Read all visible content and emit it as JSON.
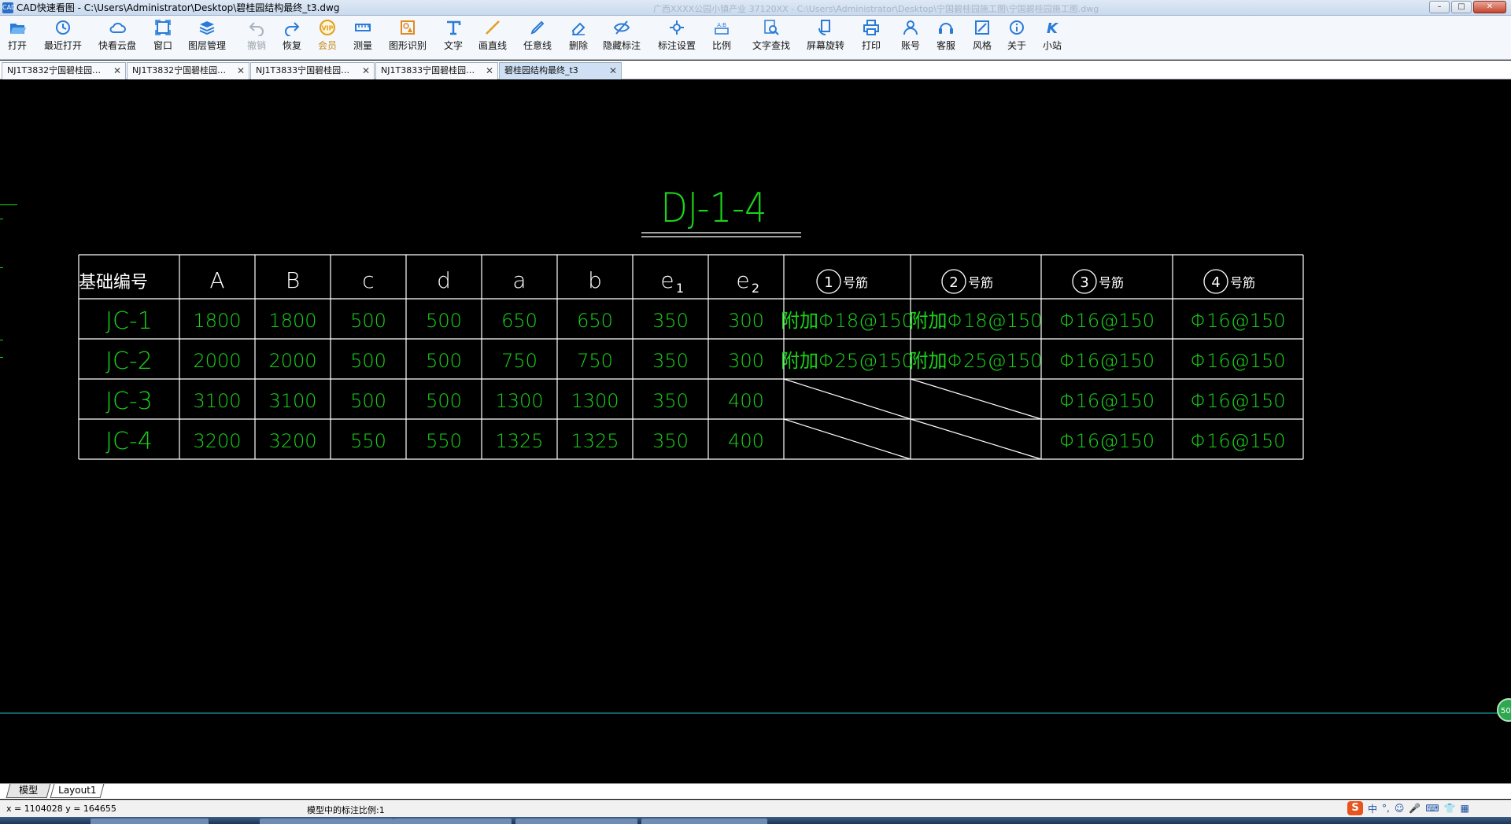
{
  "window": {
    "app_icon": "CAD",
    "title": "CAD快速看图 - C:\\Users\\Administrator\\Desktop\\碧桂园结构最终_t3.dwg",
    "ghost_title": "广西XXXX公园小镇产业 37120XX - C:\\Users\\Administrator\\Desktop\\宁国碧桂园施工图\\宁国碧桂园施工图.dwg",
    "minimize": "–",
    "maximize": "□",
    "close": "✕"
  },
  "toolbar": [
    {
      "id": "open",
      "label": "打开",
      "icon": "folder-open-icon",
      "color": "#2a7bd6"
    },
    {
      "id": "recent",
      "label": "最近打开",
      "icon": "clock-icon",
      "color": "#2a7bd6"
    },
    {
      "id": "cloud",
      "label": "快看云盘",
      "icon": "cloud-icon",
      "color": "#2a7bd6"
    },
    {
      "id": "window",
      "label": "窗口",
      "icon": "window-icon",
      "color": "#2a7bd6"
    },
    {
      "id": "layers",
      "label": "图层管理",
      "icon": "layers-icon",
      "color": "#2a7bd6"
    },
    {
      "id": "undo",
      "label": "撤销",
      "icon": "undo-icon",
      "color": "#a8b3bf",
      "disabled": true
    },
    {
      "id": "redo",
      "label": "恢复",
      "icon": "redo-icon",
      "color": "#2a7bd6"
    },
    {
      "id": "vip",
      "label": "会员",
      "icon": "vip-icon",
      "color": "#e0a020"
    },
    {
      "id": "measure",
      "label": "测量",
      "icon": "ruler-icon",
      "color": "#2a7bd6"
    },
    {
      "id": "shape-recog",
      "label": "图形识别",
      "icon": "shape-recognition-icon",
      "color": "#e08a20"
    },
    {
      "id": "text",
      "label": "文字",
      "icon": "text-icon",
      "color": "#2a7bd6"
    },
    {
      "id": "line",
      "label": "画直线",
      "icon": "line-icon",
      "color": "#e0a020"
    },
    {
      "id": "freeline",
      "label": "任意线",
      "icon": "pen-icon",
      "color": "#2a7bd6"
    },
    {
      "id": "delete",
      "label": "删除",
      "icon": "eraser-icon",
      "color": "#2a7bd6"
    },
    {
      "id": "hide-anno",
      "label": "隐藏标注",
      "icon": "eye-hide-icon",
      "color": "#2a7bd6"
    },
    {
      "id": "anno-settings",
      "label": "标注设置",
      "icon": "annotation-settings-icon",
      "color": "#2a7bd6"
    },
    {
      "id": "scale",
      "label": "比例",
      "icon": "scale-icon",
      "color": "#2a7bd6"
    },
    {
      "id": "text-find",
      "label": "文字查找",
      "icon": "text-search-icon",
      "color": "#2a7bd6"
    },
    {
      "id": "rotate",
      "label": "屏幕旋转",
      "icon": "screen-rotate-icon",
      "color": "#2a7bd6"
    },
    {
      "id": "print",
      "label": "打印",
      "icon": "printer-icon",
      "color": "#2a7bd6"
    },
    {
      "id": "account",
      "label": "账号",
      "icon": "user-icon",
      "color": "#2a7bd6"
    },
    {
      "id": "service",
      "label": "客服",
      "icon": "headset-icon",
      "color": "#2a7bd6"
    },
    {
      "id": "style",
      "label": "风格",
      "icon": "style-icon",
      "color": "#2a7bd6"
    },
    {
      "id": "about",
      "label": "关于",
      "icon": "info-icon",
      "color": "#2a7bd6"
    },
    {
      "id": "station",
      "label": "小站",
      "icon": "k-logo-icon",
      "color": "#2a7bd6"
    }
  ],
  "tabs": [
    {
      "label": "NJ1T3832宁国碧桂园…",
      "close": "✕",
      "active": false
    },
    {
      "label": "NJ1T3832宁国碧桂园…",
      "close": "✕",
      "active": false
    },
    {
      "label": "NJ1T3833宁国碧桂园…",
      "close": "✕",
      "active": false
    },
    {
      "label": "NJ1T3833宁国碧桂园…",
      "close": "✕",
      "active": false
    },
    {
      "label": "碧桂园结构最终_t3",
      "close": "✕",
      "active": true
    }
  ],
  "drawing": {
    "title": "DJ-1-4",
    "headers": [
      "基础编号",
      "A",
      "B",
      "c",
      "d",
      "a",
      "b",
      "e1",
      "e2",
      "①号筋",
      "②号筋",
      "③号筋",
      "④号筋"
    ],
    "header_main": [
      "基础编号",
      "A",
      "B",
      "c",
      "d",
      "a",
      "b",
      "e",
      "e"
    ],
    "header_sub": [
      "",
      "",
      "",
      "",
      "",
      "",
      "",
      "1",
      "2"
    ],
    "circled": [
      {
        "num": "1",
        "suffix": "号筋"
      },
      {
        "num": "2",
        "suffix": "号筋"
      },
      {
        "num": "3",
        "suffix": "号筋"
      },
      {
        "num": "4",
        "suffix": "号筋"
      }
    ],
    "rows": [
      {
        "id": "JC-1",
        "vals": [
          "1800",
          "1800",
          "500",
          "500",
          "650",
          "650",
          "350",
          "300"
        ],
        "r1": "附加Φ18@150",
        "r2": "附加Φ18@150",
        "r3": "Φ16@150",
        "r4": "Φ16@150"
      },
      {
        "id": "JC-2",
        "vals": [
          "2000",
          "2000",
          "500",
          "500",
          "750",
          "750",
          "350",
          "300"
        ],
        "r1": "附加Φ25@150",
        "r2": "附加Φ25@150",
        "r3": "Φ16@150",
        "r4": "Φ16@150"
      },
      {
        "id": "JC-3",
        "vals": [
          "3100",
          "3100",
          "500",
          "500",
          "1300",
          "1300",
          "350",
          "400"
        ],
        "r1": null,
        "r2": null,
        "r3": "Φ16@150",
        "r4": "Φ16@150"
      },
      {
        "id": "JC-4",
        "vals": [
          "3200",
          "3200",
          "550",
          "550",
          "1325",
          "1325",
          "350",
          "400"
        ],
        "r1": null,
        "r2": null,
        "r3": "Φ16@150",
        "r4": "Φ16@150"
      }
    ],
    "colors": {
      "text": "#19d419",
      "header": "#ffffff",
      "grid": "#ffffff",
      "axis": "#22c4c4",
      "background": "#000000"
    }
  },
  "zoom_badge": "50",
  "layout_tabs": [
    "模型",
    "Layout1"
  ],
  "status": {
    "coords": "x = 1104028  y = 164655",
    "scale": "模型中的标注比例:1"
  },
  "ime": {
    "logo": "S",
    "items": [
      "中",
      "°,",
      "☺",
      "🎤",
      "⌨",
      "👕",
      "▦"
    ]
  }
}
